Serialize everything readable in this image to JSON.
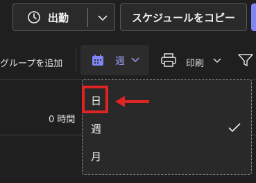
{
  "header": {
    "clock_in_label": "出勤",
    "copy_schedule_label": "スケジュールをコピー"
  },
  "toolbar": {
    "add_group_label": "グループを追加",
    "view_label": "週",
    "print_label": "印刷"
  },
  "grid": {
    "hours_label": "0 時間"
  },
  "view_menu": {
    "items": [
      {
        "label": "日",
        "highlighted": true
      },
      {
        "label": "週",
        "checked": true
      },
      {
        "label": "月"
      }
    ]
  },
  "colors": {
    "accent": "#7f85f5",
    "annotation": "#e02424",
    "background": "#1f1f1f",
    "menu_background": "#292929"
  },
  "icons": [
    "clock-icon",
    "chevron-down-icon",
    "calendar-icon",
    "printer-icon",
    "filter-icon",
    "checkmark-icon",
    "arrow-left-icon"
  ]
}
